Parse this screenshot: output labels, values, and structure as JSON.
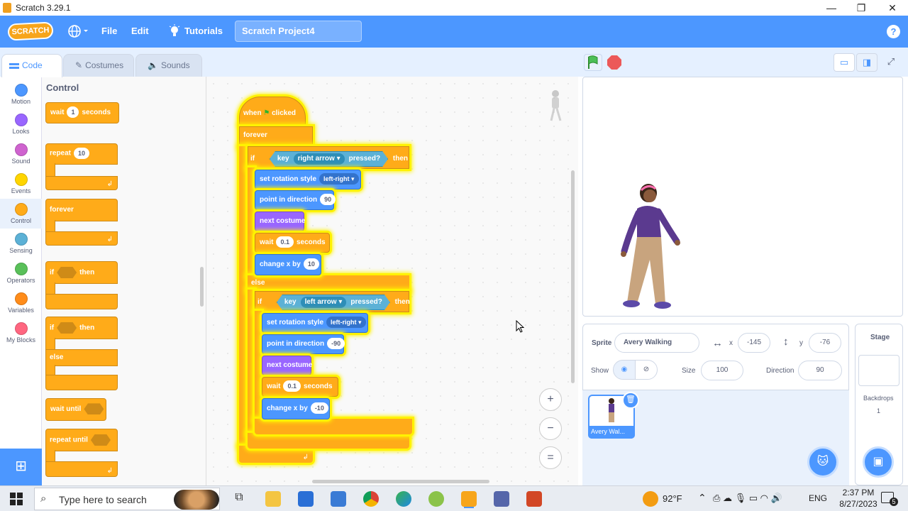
{
  "window": {
    "title": "Scratch 3.29.1",
    "minimize": "—",
    "maximize": "❐",
    "close": "✕"
  },
  "menubar": {
    "logo": "SCRATCH",
    "language_icon": "globe-icon",
    "file": "File",
    "edit": "Edit",
    "tutorials": "Tutorials",
    "project_title": "Scratch Project4",
    "help": "?"
  },
  "tabs": [
    {
      "label": "Code"
    },
    {
      "label": "Costumes"
    },
    {
      "label": "Sounds"
    }
  ],
  "categories": [
    {
      "label": "Motion",
      "color": "#4c97ff"
    },
    {
      "label": "Looks",
      "color": "#9966ff"
    },
    {
      "label": "Sound",
      "color": "#cf63cf"
    },
    {
      "label": "Events",
      "color": "#ffd500"
    },
    {
      "label": "Control",
      "color": "#ffab19"
    },
    {
      "label": "Sensing",
      "color": "#5cb1d6"
    },
    {
      "label": "Operators",
      "color": "#59c059"
    },
    {
      "label": "Variables",
      "color": "#ff8c1a"
    },
    {
      "label": "My Blocks",
      "color": "#ff6680"
    }
  ],
  "palette": {
    "title": "Control",
    "wait": "wait",
    "wait_value": "1",
    "seconds": "seconds",
    "repeat": "repeat",
    "repeat_value": "10",
    "forever": "forever",
    "if": "if",
    "then": "then",
    "if2": "if",
    "then2": "then",
    "else": "else",
    "wait_until": "wait until",
    "repeat_until": "repeat until"
  },
  "script": {
    "when": "when",
    "clicked": "clicked",
    "forever": "forever",
    "if1": "if",
    "key1": "key",
    "right_arrow": "right arrow",
    "pressed1": "pressed?",
    "then1": "then",
    "set_rot1": "set rotation style",
    "left_right1": "left-right",
    "point1": "point in direction",
    "dir1": "90",
    "next1": "next costume",
    "wait1": "wait",
    "wait1_val": "0.1",
    "seconds1": "seconds",
    "changex1": "change x by",
    "changex1_val": "10",
    "else": "else",
    "if2": "if",
    "key2": "key",
    "left_arrow": "left arrow",
    "pressed2": "pressed?",
    "then2": "then",
    "set_rot2": "set rotation style",
    "left_right2": "left-right",
    "point2": "point in direction",
    "dir2": "-90",
    "next2": "next costume",
    "wait2": "wait",
    "wait2_val": "0.1",
    "seconds2": "seconds",
    "changex2": "change x by",
    "changex2_val": "-10"
  },
  "zoom": {
    "in": "+",
    "out": "−",
    "reset": "="
  },
  "sprite_info": {
    "sprite_label": "Sprite",
    "sprite_name": "Avery Walking",
    "x_label": "x",
    "x_value": "-145",
    "y_label": "y",
    "y_value": "-76",
    "show_label": "Show",
    "size_label": "Size",
    "size_value": "100",
    "direction_label": "Direction",
    "direction_value": "90"
  },
  "sprites": [
    {
      "name": "Avery Wal..."
    }
  ],
  "stage_panel": {
    "title": "Stage",
    "backdrops_label": "Backdrops",
    "backdrops_count": "1"
  },
  "taskbar": {
    "search_placeholder": "Type here to search",
    "temperature": "92°F",
    "language": "ENG",
    "time": "2:37 PM",
    "date": "8/27/2023",
    "notifications": "5"
  }
}
